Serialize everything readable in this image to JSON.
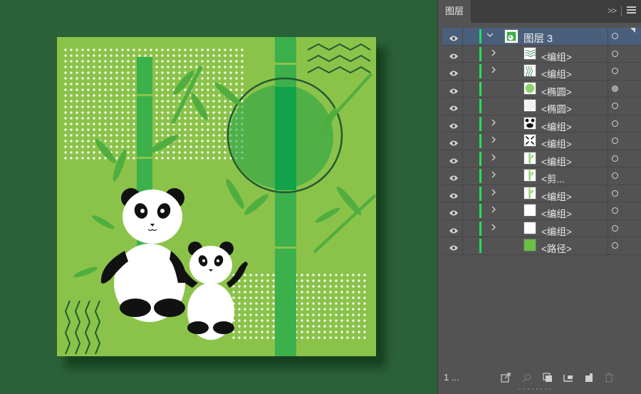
{
  "panel": {
    "tab_label": "图层",
    "collapse_label": ">>",
    "layer_count": "1 ..."
  },
  "layers": [
    {
      "name": "图层 3",
      "expanded": true,
      "has_chevron": true,
      "target": "open",
      "selected": true,
      "thumb": "layer"
    },
    {
      "name": "<编组>",
      "has_chevron": true,
      "target": "open",
      "thumb": "waves-h"
    },
    {
      "name": "<编组>",
      "has_chevron": true,
      "target": "open",
      "thumb": "waves-v"
    },
    {
      "name": "<椭圆>",
      "has_chevron": false,
      "target": "filled",
      "thumb": "ellipse-green"
    },
    {
      "name": "<椭圆>",
      "has_chevron": false,
      "target": "open",
      "thumb": "ellipse-white"
    },
    {
      "name": "<编组>",
      "has_chevron": true,
      "target": "open",
      "thumb": "panda-a"
    },
    {
      "name": "<编组>",
      "has_chevron": true,
      "target": "open",
      "thumb": "panda-b"
    },
    {
      "name": "<编组>",
      "has_chevron": true,
      "target": "open",
      "thumb": "bamboo"
    },
    {
      "name": "<剪...",
      "has_chevron": true,
      "target": "open",
      "thumb": "bamboo"
    },
    {
      "name": "<编组>",
      "has_chevron": true,
      "target": "open",
      "thumb": "bamboo"
    },
    {
      "name": "<编组>",
      "has_chevron": true,
      "target": "open",
      "thumb": "blank"
    },
    {
      "name": "<编组>",
      "has_chevron": true,
      "target": "open",
      "thumb": "blank"
    },
    {
      "name": "<路径>",
      "has_chevron": false,
      "target": "open",
      "thumb": "green-fill"
    }
  ],
  "colors": {
    "canvas_bg": "#2a6136",
    "artboard_bg": "#8bc34a",
    "bamboo": "#3cb04a",
    "circle": "#1ea144",
    "outline": "#1f5a33",
    "layer_color": "#1ee35a"
  },
  "icons": [
    "eye-icon",
    "chevron-right-icon",
    "chevron-down-icon",
    "target-circle-icon",
    "collect-export-icon",
    "locate-object-icon",
    "make-clipping-mask-icon",
    "new-sublayer-icon",
    "new-layer-icon",
    "trash-icon",
    "panel-menu-icon"
  ]
}
